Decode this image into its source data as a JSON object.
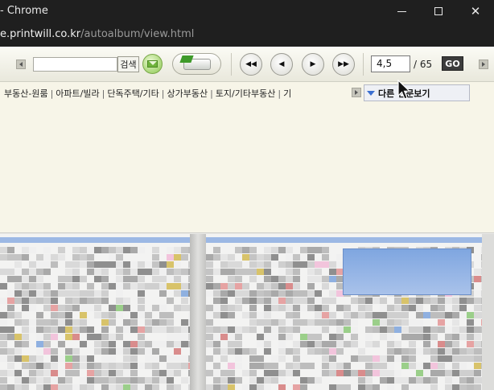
{
  "window": {
    "title": "- Chrome",
    "url_host": "e.printwill.co.kr",
    "url_path": "/autoalbum/view.html"
  },
  "toolbar": {
    "search_placeholder": "",
    "search_button": "검색",
    "page_value": "4,5",
    "page_total": "/ 65",
    "go_label": "GO"
  },
  "categories": [
    "부동산-원룸",
    "아파트/빌라",
    "단독주택/기타",
    "상가부동산",
    "토지/기타부동산",
    "기"
  ],
  "category_separator": "|",
  "other_papers_label": "다른 신문보기",
  "icons": {
    "minimize": "minimize-icon",
    "maximize": "maximize-icon",
    "close": "close-icon",
    "mail": "envelope-icon",
    "print": "printer-icon",
    "first": "first-page-icon",
    "prev": "previous-page-icon",
    "next": "next-page-icon",
    "last": "last-page-icon"
  },
  "colors": {
    "titlebar": "#1f1f1f",
    "page_bg": "#f7f5e8",
    "go_button": "#3c3c3c",
    "accent_blue": "#3b6fd0"
  }
}
